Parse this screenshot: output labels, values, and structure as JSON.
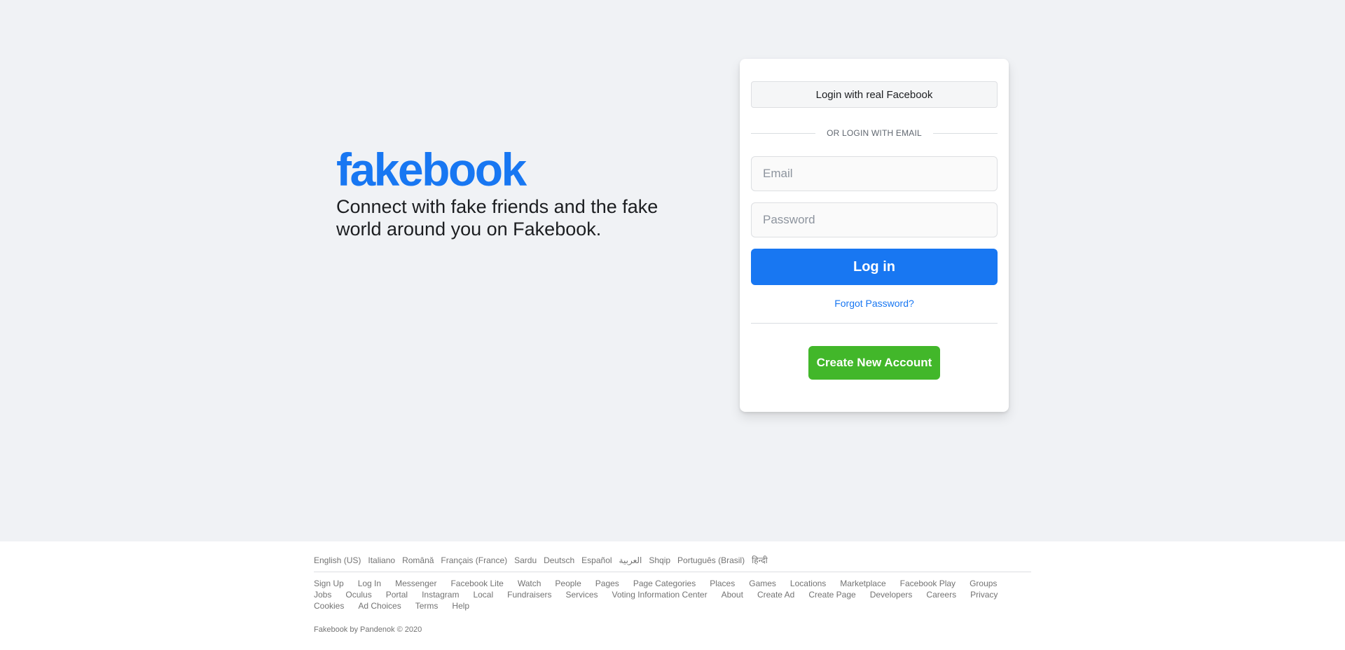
{
  "brand": {
    "logo": "fakebook",
    "tagline": "Connect with fake friends and the fake world around you on Fakebook."
  },
  "login": {
    "real_facebook_label": "Login with real Facebook",
    "divider_text": "OR LOGIN WITH EMAIL",
    "email_placeholder": "Email",
    "password_placeholder": "Password",
    "login_label": "Log in",
    "forgot_label": "Forgot Password?",
    "create_label": "Create New Account"
  },
  "footer": {
    "languages": [
      "English (US)",
      "Italiano",
      "Română",
      "Français (France)",
      "Sardu",
      "Deutsch",
      "Español",
      "العربية",
      "Shqip",
      "Português (Brasil)",
      "हिन्दी"
    ],
    "links": [
      "Sign Up",
      "Log In",
      "Messenger",
      "Facebook Lite",
      "Watch",
      "People",
      "Pages",
      "Page Categories",
      "Places",
      "Games",
      "Locations",
      "Marketplace",
      "Facebook Play",
      "Groups",
      "Jobs",
      "Oculus",
      "Portal",
      "Instagram",
      "Local",
      "Fundraisers",
      "Services",
      "Voting Information Center",
      "About",
      "Create Ad",
      "Create Page",
      "Developers",
      "Careers",
      "Privacy",
      "Cookies",
      "Ad Choices",
      "Terms",
      "Help"
    ],
    "copyright": "Fakebook by Pandenok © 2020"
  },
  "colors": {
    "brand_blue": "#1877f2",
    "create_green": "#42b72a",
    "background": "#f0f2f5"
  }
}
